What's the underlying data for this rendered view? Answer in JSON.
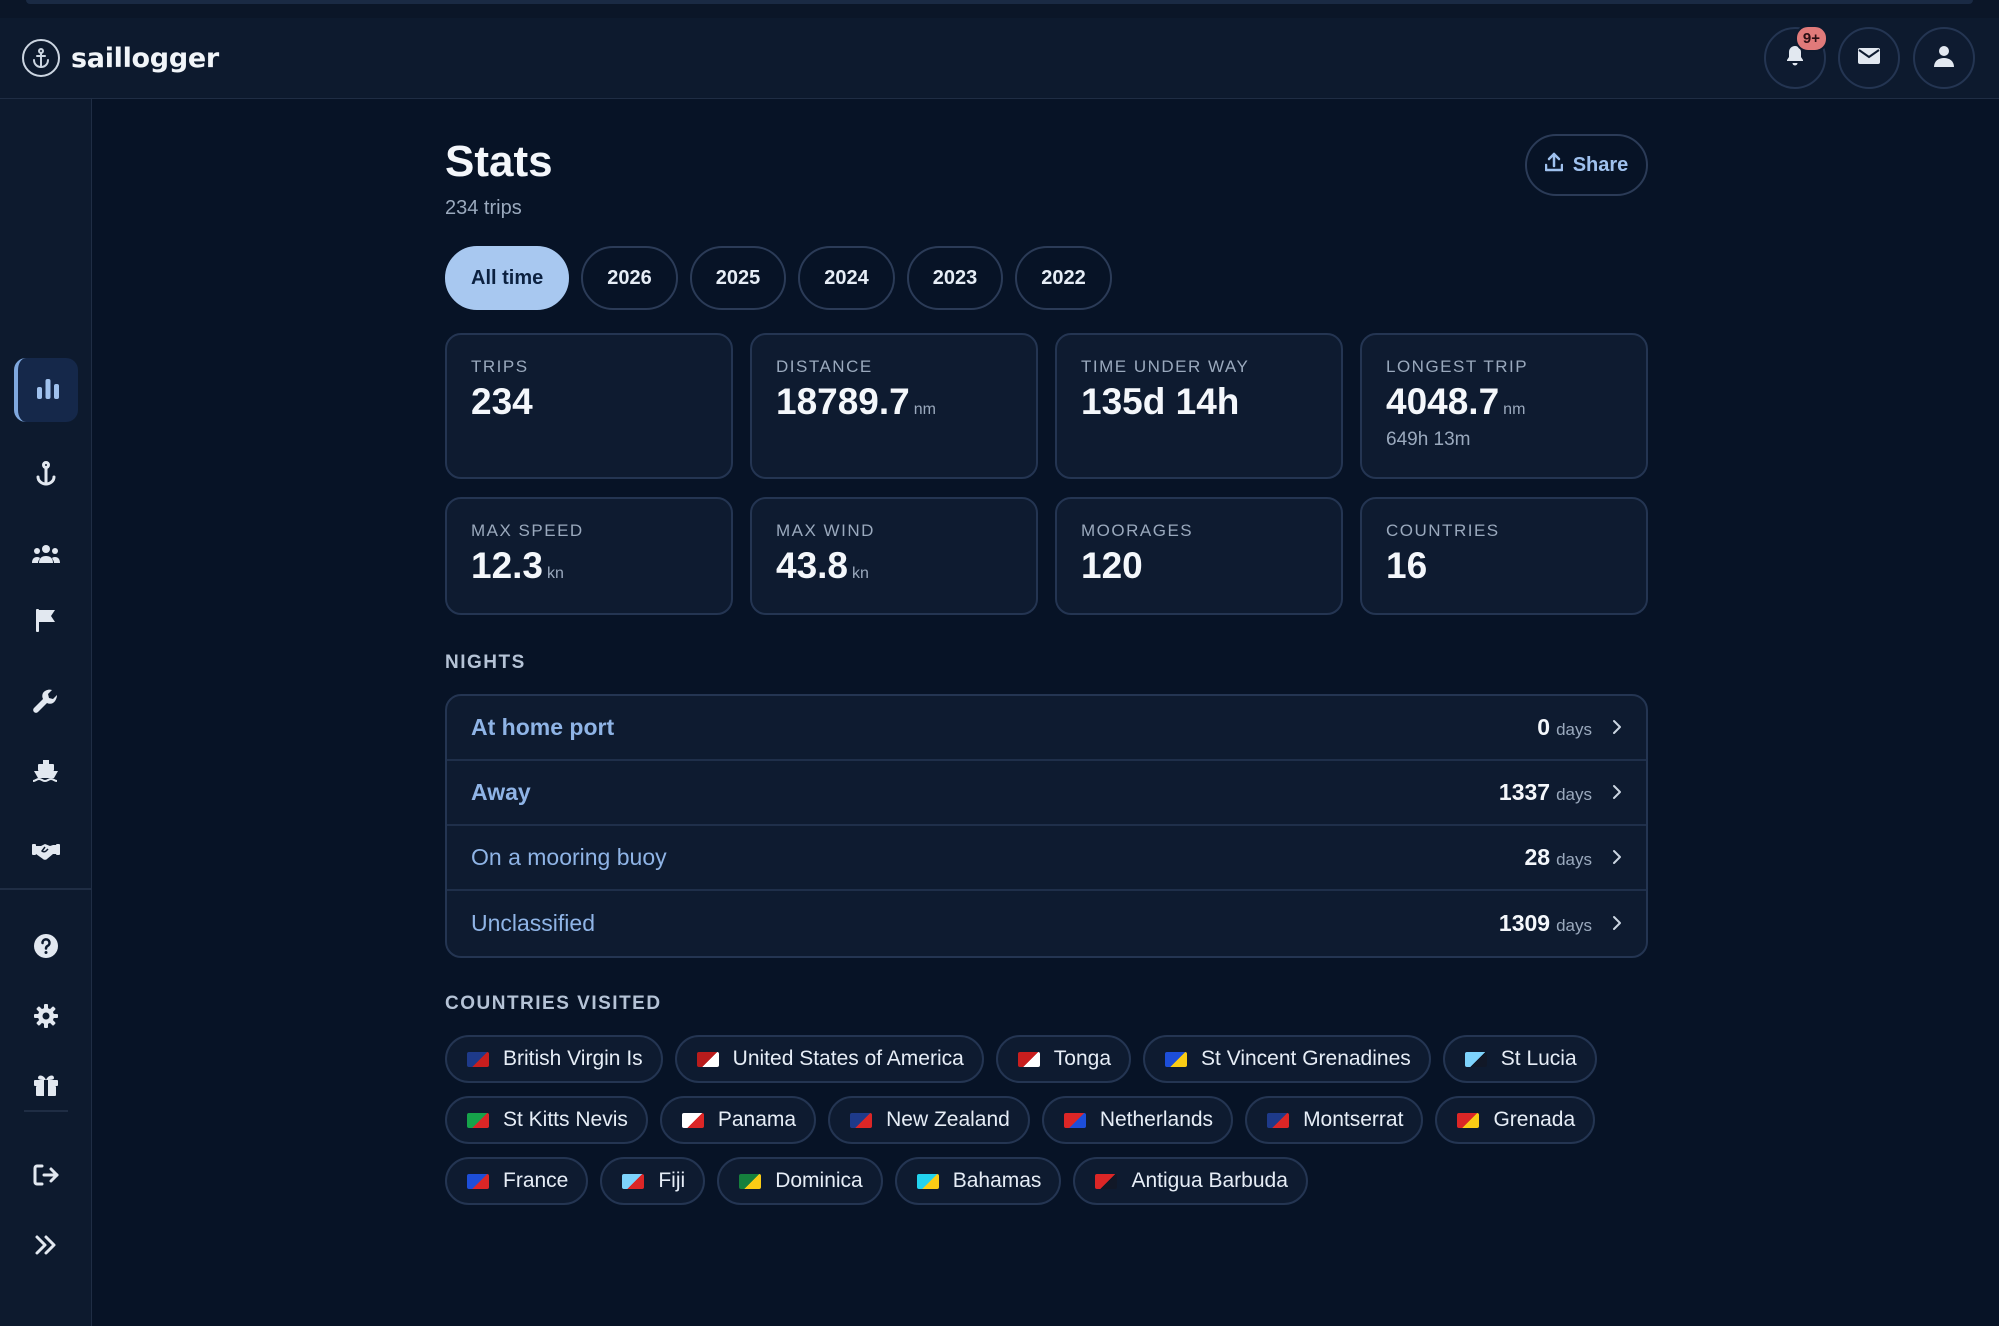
{
  "app": {
    "name": "saillogger"
  },
  "header": {
    "notifications_badge": "9+"
  },
  "sidebar": {
    "items": [
      {
        "icon": "trending-up-icon"
      },
      {
        "icon": "medal-icon"
      },
      {
        "icon": "camera-icon"
      },
      {
        "icon": "book-icon"
      },
      {
        "icon": "bar-chart-icon",
        "active": true
      },
      {
        "icon": "anchor-icon"
      },
      {
        "icon": "users-icon"
      },
      {
        "icon": "flag-icon"
      },
      {
        "icon": "wrench-icon"
      },
      {
        "icon": "ship-icon"
      },
      {
        "icon": "handshake-icon"
      }
    ],
    "bottom": [
      {
        "icon": "help-icon"
      },
      {
        "icon": "settings-icon"
      },
      {
        "icon": "gift-icon"
      },
      {
        "icon": "logout-icon"
      },
      {
        "icon": "expand-icon"
      }
    ]
  },
  "page": {
    "title": "Stats",
    "subtitle": "234 trips",
    "share_label": "Share"
  },
  "tabs": [
    "All time",
    "2026",
    "2025",
    "2024",
    "2023",
    "2022"
  ],
  "active_tab": "All time",
  "stats": [
    {
      "label": "TRIPS",
      "value": "234",
      "unit": ""
    },
    {
      "label": "DISTANCE",
      "value": "18789.7",
      "unit": "nm"
    },
    {
      "label": "TIME UNDER WAY",
      "value": "135d 14h",
      "unit": ""
    },
    {
      "label": "LONGEST TRIP",
      "value": "4048.7",
      "unit": "nm",
      "sub": "649h 13m"
    },
    {
      "label": "MAX SPEED",
      "value": "12.3",
      "unit": "kn"
    },
    {
      "label": "MAX WIND",
      "value": "43.8",
      "unit": "kn"
    },
    {
      "label": "MOORAGES",
      "value": "120",
      "unit": ""
    },
    {
      "label": "COUNTRIES",
      "value": "16",
      "unit": ""
    }
  ],
  "nights": {
    "heading": "NIGHTS",
    "rows": [
      {
        "label": "At home port",
        "value": "0",
        "unit": "days",
        "bold": true
      },
      {
        "label": "Away",
        "value": "1337",
        "unit": "days",
        "bold": true
      },
      {
        "label": "On a mooring buoy",
        "value": "28",
        "unit": "days",
        "bold": false
      },
      {
        "label": "Unclassified",
        "value": "1309",
        "unit": "days",
        "bold": false
      }
    ]
  },
  "countries": {
    "heading": "COUNTRIES VISITED",
    "rows": [
      [
        {
          "name": "British Virgin Is",
          "colors": [
            "#1e3a8a",
            "#c81e1e"
          ]
        },
        {
          "name": "United States of America",
          "colors": [
            "#b91c1c",
            "#ffffff"
          ]
        },
        {
          "name": "Tonga",
          "colors": [
            "#c81e1e",
            "#ffffff"
          ]
        },
        {
          "name": "St Vincent Grenadines",
          "colors": [
            "#1d4ed8",
            "#facc15"
          ]
        },
        {
          "name": "St Lucia",
          "colors": [
            "#7dd3fc",
            "#111827"
          ]
        }
      ],
      [
        {
          "name": "St Kitts Nevis",
          "colors": [
            "#16a34a",
            "#dc2626"
          ]
        },
        {
          "name": "Panama",
          "colors": [
            "#ffffff",
            "#dc2626"
          ]
        },
        {
          "name": "New Zealand",
          "colors": [
            "#1e3a8a",
            "#dc2626"
          ]
        },
        {
          "name": "Netherlands",
          "colors": [
            "#dc2626",
            "#1d4ed8"
          ]
        },
        {
          "name": "Montserrat",
          "colors": [
            "#1e3a8a",
            "#dc2626"
          ]
        },
        {
          "name": "Grenada",
          "colors": [
            "#dc2626",
            "#facc15"
          ]
        }
      ],
      [
        {
          "name": "France",
          "colors": [
            "#1d4ed8",
            "#dc2626"
          ]
        },
        {
          "name": "Fiji",
          "colors": [
            "#7dd3fc",
            "#dc2626"
          ]
        },
        {
          "name": "Dominica",
          "colors": [
            "#15803d",
            "#facc15"
          ]
        },
        {
          "name": "Bahamas",
          "colors": [
            "#22d3ee",
            "#facc15"
          ]
        },
        {
          "name": "Antigua Barbuda",
          "colors": [
            "#dc2626",
            "#111827"
          ]
        }
      ]
    ]
  }
}
